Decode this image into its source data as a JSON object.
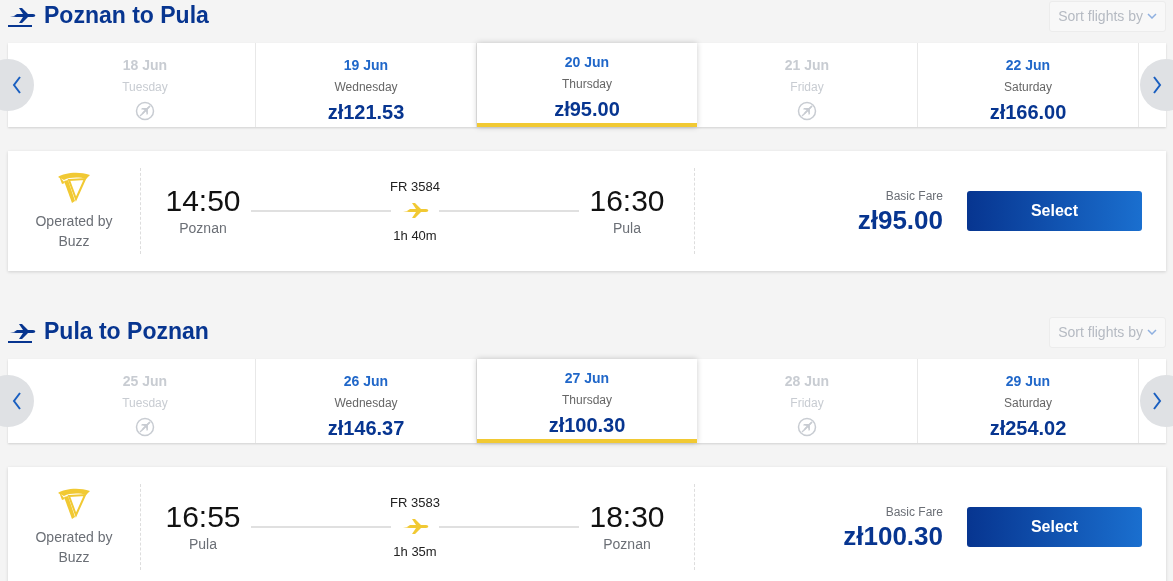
{
  "journeys": [
    {
      "title": "Poznan to Pula",
      "sort": {
        "label": "Sort flights by"
      },
      "dates": [
        {
          "date": "18 Jun",
          "weekday": "Tuesday",
          "available": false,
          "selected": false
        },
        {
          "date": "19 Jun",
          "weekday": "Wednesday",
          "price": "zł121.53",
          "available": true,
          "selected": false
        },
        {
          "date": "20 Jun",
          "weekday": "Thursday",
          "price": "zł95.00",
          "available": true,
          "selected": true
        },
        {
          "date": "21 Jun",
          "weekday": "Friday",
          "available": false,
          "selected": false
        },
        {
          "date": "22 Jun",
          "weekday": "Saturday",
          "price": "zł166.00",
          "available": true,
          "selected": false
        }
      ],
      "flight": {
        "operator_label": "Operated by",
        "operator": "Buzz",
        "departure_time": "14:50",
        "departure_city": "Poznan",
        "flight_number": "FR 3584",
        "duration": "1h 40m",
        "arrival_time": "16:30",
        "arrival_city": "Pula",
        "fare_label": "Basic Fare",
        "price": "zł95.00",
        "button": "Select"
      }
    },
    {
      "title": "Pula to Poznan",
      "sort": {
        "label": "Sort flights by"
      },
      "dates": [
        {
          "date": "25 Jun",
          "weekday": "Tuesday",
          "available": false,
          "selected": false
        },
        {
          "date": "26 Jun",
          "weekday": "Wednesday",
          "price": "zł146.37",
          "available": true,
          "selected": false
        },
        {
          "date": "27 Jun",
          "weekday": "Thursday",
          "price": "zł100.30",
          "available": true,
          "selected": true
        },
        {
          "date": "28 Jun",
          "weekday": "Friday",
          "available": false,
          "selected": false
        },
        {
          "date": "29 Jun",
          "weekday": "Saturday",
          "price": "zł254.02",
          "available": true,
          "selected": false
        }
      ],
      "flight": {
        "operator_label": "Operated by",
        "operator": "Buzz",
        "departure_time": "16:55",
        "departure_city": "Pula",
        "flight_number": "FR 3583",
        "duration": "1h 35m",
        "arrival_time": "18:30",
        "arrival_city": "Poznan",
        "fare_label": "Basic Fare",
        "price": "zł100.30",
        "button": "Select"
      }
    }
  ]
}
